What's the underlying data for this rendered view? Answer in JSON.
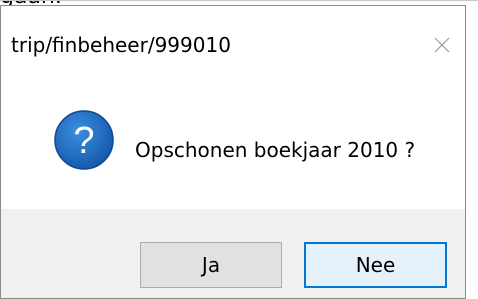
{
  "background": {
    "partial_text": "gaan."
  },
  "dialog": {
    "title": "trip/finbeheer/999010",
    "close_icon": "close-icon",
    "message_icon": "question-icon",
    "message": "Opschonen boekjaar 2010 ?",
    "buttons": {
      "yes_label": "Ja",
      "no_label": "Nee"
    }
  },
  "colors": {
    "footer_bg": "#f0f0f0",
    "default_button_border": "#0078d7",
    "icon_blue": "#1f6fc5"
  }
}
